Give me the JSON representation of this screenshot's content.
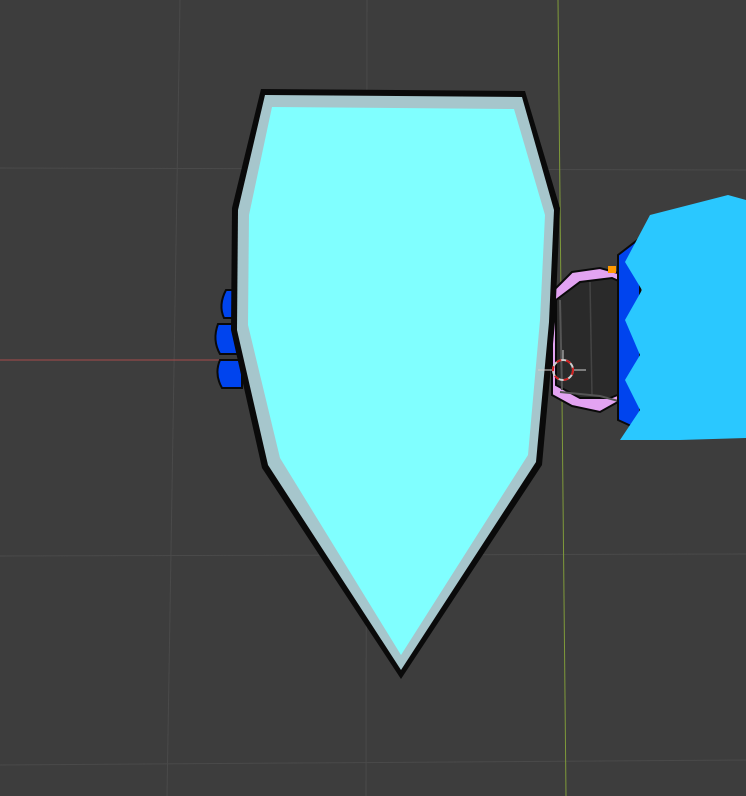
{
  "viewport": {
    "background": "#3d3d3d",
    "grid_line_color": "#4a4a4a",
    "x_axis_color": "#a84a4a",
    "y_axis_color": "#7f9a3a"
  },
  "objects": {
    "shield": {
      "outline": "#0a0a0a",
      "rim": "#a6c6cc",
      "face": "#80ffff"
    },
    "hand_fingers": {
      "color": "#0044ee",
      "outline": "#0a0a0a"
    },
    "arm": {
      "sleeve_color": "#2a2a2a",
      "cuff_color": "#e3a3f2",
      "accent_color": "#ff9900"
    },
    "body_cape": {
      "light_color": "#2ac8ff",
      "dark_color": "#0044ee"
    }
  },
  "cursor_3d": {
    "icon": "3d-cursor-icon",
    "ring_color": "#d0d0d0",
    "dash_color": "#d02020"
  }
}
